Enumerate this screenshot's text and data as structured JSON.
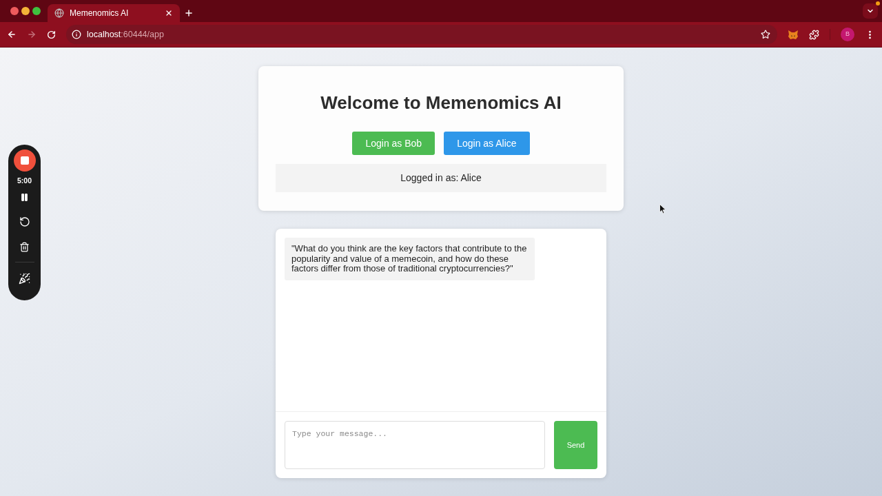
{
  "browser": {
    "tabs": [
      {
        "title": "Memenomics AI",
        "selected": true
      }
    ],
    "url": {
      "host": "localhost",
      "path": ":60444/app"
    },
    "profile_initial": "B"
  },
  "recorder": {
    "timer": "5:00"
  },
  "login": {
    "title": "Welcome to Memenomics AI",
    "buttons": [
      {
        "label": "Login as Bob",
        "color": "#4cbb52"
      },
      {
        "label": "Login as Alice",
        "color": "#2e97e9"
      }
    ],
    "status": "Logged in as: Alice"
  },
  "chat": {
    "messages": [
      {
        "text": "\"What do you think are the key factors that contribute to the popularity and value of a memecoin, and how do these factors differ from those of traditional cryptocurrencies?\""
      }
    ],
    "input": {
      "placeholder": "Type your message..."
    },
    "send_button": {
      "label": "Send"
    }
  }
}
